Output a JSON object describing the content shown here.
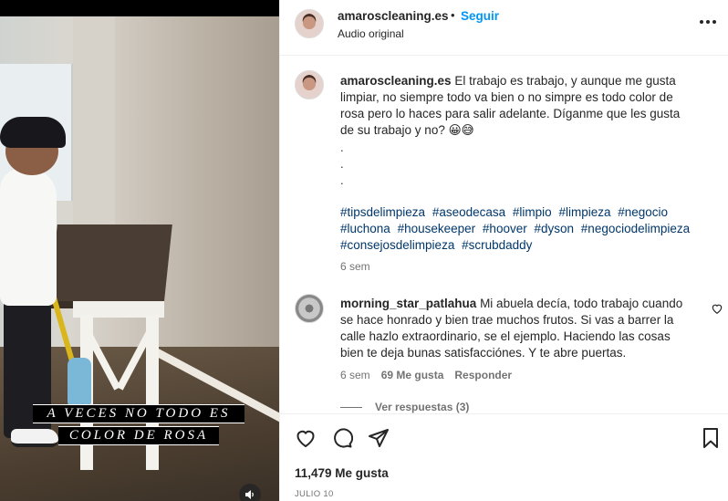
{
  "post": {
    "video_caption_lines": [
      "A VECES NO TODO ES",
      "COLOR DE ROSA"
    ],
    "sound_icon": "speaker-icon"
  },
  "header": {
    "username": "amaroscleaning.es",
    "separator": "•",
    "follow_label": "Seguir",
    "audio_label": "Audio original",
    "more_icon": "more-options-icon"
  },
  "caption": {
    "username": "amaroscleaning.es",
    "text": "El trabajo es trabajo, y aunque me gusta limpiar, no siempre todo va bien o no simpre es todo color de rosa pero lo haces para salir adelante. Díganme que les gusta de su trabajo y no? 😀😅",
    "dots": [
      ".",
      ".",
      "."
    ],
    "hashtags": [
      "#tipsdelimpieza",
      "#aseodecasa",
      "#limpio",
      "#limpieza",
      "#negocio",
      "#luchona",
      "#housekeeper",
      "#hoover",
      "#dyson",
      "#negociodelimpieza",
      "#consejosdelimpieza",
      "#scrubdaddy"
    ],
    "time": "6 sem"
  },
  "comments": [
    {
      "username": "morning_star_patlahua",
      "text": "Mi abuela decía, todo trabajo cuando se hace honrado y bien trae muchos frutos. Si vas a barrer la calle hazlo extraordinario, se el ejemplo. Haciendo las cosas bien te deja bunas satisfacciónes. Y te abre puertas.",
      "time": "6 sem",
      "likes": "69 Me gusta",
      "reply_label": "Responder",
      "view_replies": "Ver respuestas (3)"
    }
  ],
  "actions": {
    "likes_count": "11,479 Me gusta",
    "date": "JULIO 10"
  },
  "colors": {
    "accent": "#0095f6",
    "hashtag": "#00376b",
    "muted": "#737373",
    "text": "#262626"
  }
}
